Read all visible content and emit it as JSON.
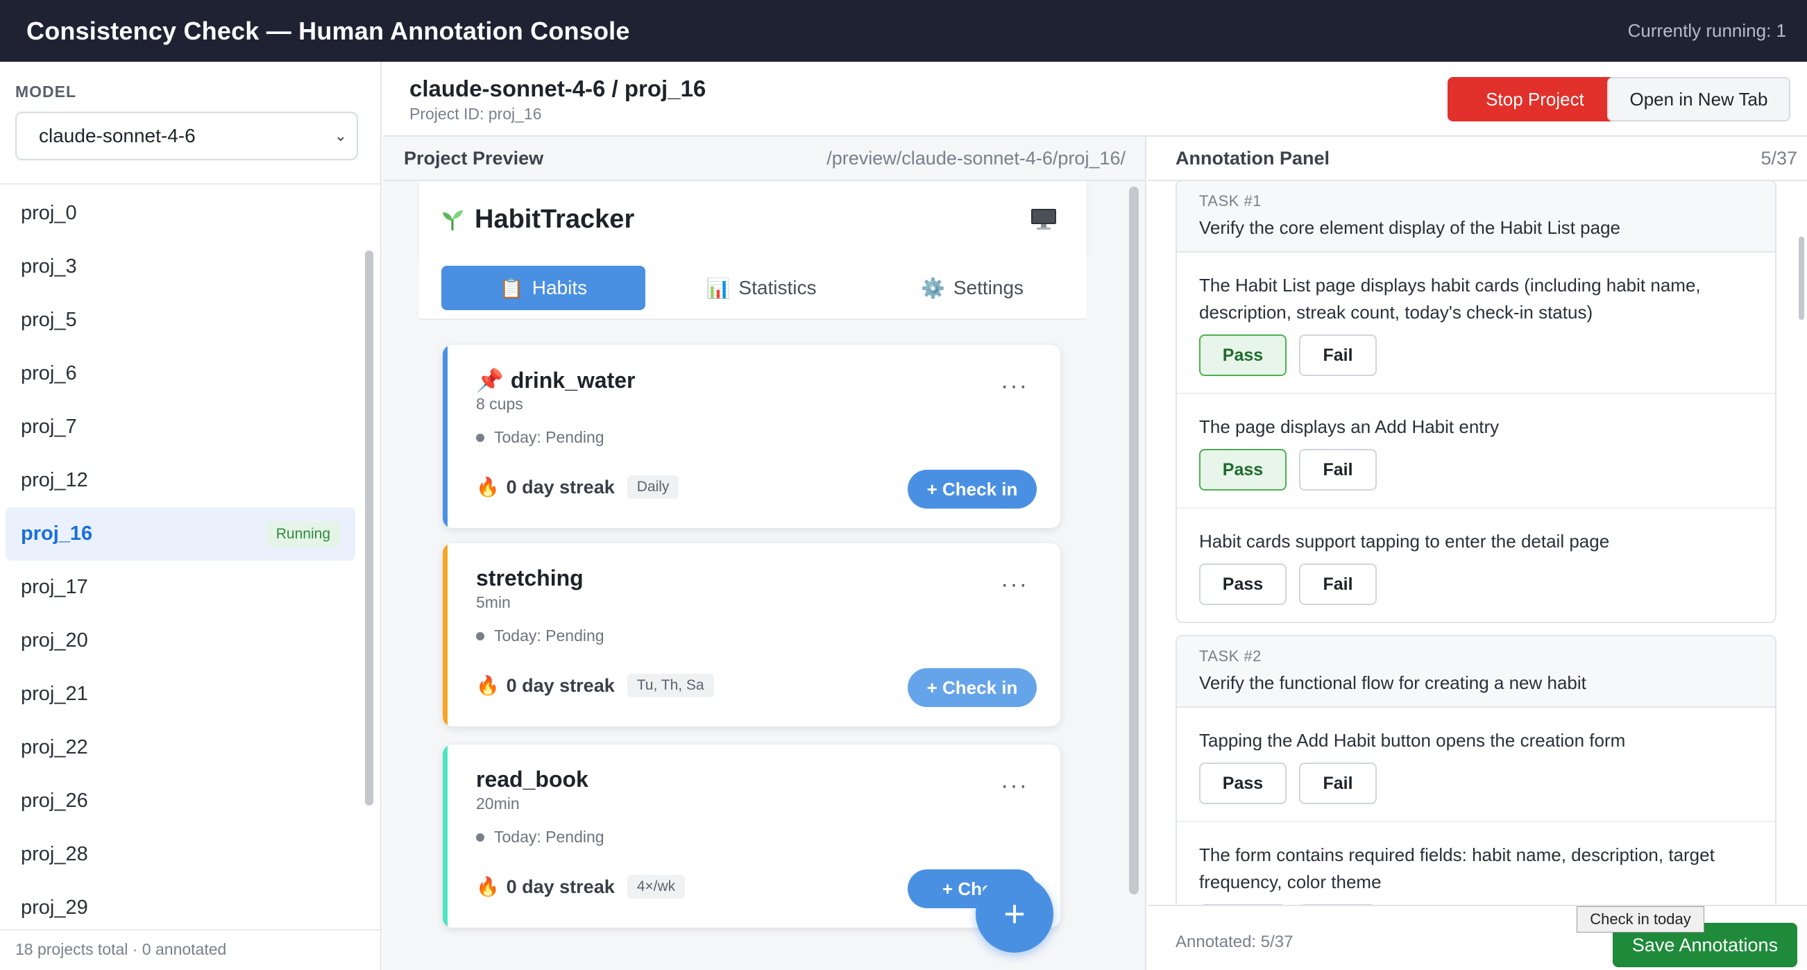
{
  "topbar": {
    "title": "Consistency Check — Human Annotation Console",
    "running": "Currently running: 1"
  },
  "sidebar": {
    "model_label": "MODEL",
    "model_value": "claude-sonnet-4-6",
    "projects": [
      {
        "label": "proj_0"
      },
      {
        "label": "proj_3"
      },
      {
        "label": "proj_5"
      },
      {
        "label": "proj_6"
      },
      {
        "label": "proj_7"
      },
      {
        "label": "proj_12"
      },
      {
        "label": "proj_16",
        "badge": "Running",
        "active": true
      },
      {
        "label": "proj_17"
      },
      {
        "label": "proj_20"
      },
      {
        "label": "proj_21"
      },
      {
        "label": "proj_22"
      },
      {
        "label": "proj_26"
      },
      {
        "label": "proj_28"
      },
      {
        "label": "proj_29"
      }
    ],
    "footer": "18 projects total · 0 annotated"
  },
  "main": {
    "title": "claude-sonnet-4-6 / proj_16",
    "subtitle": "Project ID: proj_16",
    "stop_label": "Stop Project",
    "open_label": "Open in New Tab"
  },
  "preview": {
    "label": "Project Preview",
    "path": "/preview/claude-sonnet-4-6/proj_16/",
    "app": {
      "name": "HabitTracker",
      "tabs": [
        {
          "icon": "📋",
          "label": "Habits"
        },
        {
          "icon": "📊",
          "label": "Statistics"
        },
        {
          "icon": "⚙️",
          "label": "Settings"
        }
      ],
      "cards": [
        {
          "pin": "📌",
          "name": "drink_water",
          "desc": "8 cups",
          "status": "Today: Pending",
          "streak": "0 day streak",
          "freq": "Daily",
          "checkin": "+ Check in",
          "color": "#4a90e2"
        },
        {
          "pin": "",
          "name": "stretching",
          "desc": "5min",
          "status": "Today: Pending",
          "streak": "0 day streak",
          "freq": "Tu, Th, Sa",
          "checkin": "+ Check in",
          "color": "#f5a623"
        },
        {
          "pin": "",
          "name": "read_book",
          "desc": "20min",
          "status": "Today: Pending",
          "streak": "0 day streak",
          "freq": "4×/wk",
          "checkin": "+ Chec",
          "color": "#50e3c2"
        }
      ],
      "more": "···",
      "fab": "+"
    }
  },
  "annotation": {
    "label": "Annotation Panel",
    "count": "5/37",
    "pass_label": "Pass",
    "fail_label": "Fail",
    "tasks": [
      {
        "no": "TASK #1",
        "title": "Verify the core element display of the Habit List page",
        "criteria": [
          "The Habit List page displays habit cards (including habit name, description, streak count, today's check-in status)",
          "The page displays an Add Habit entry",
          "Habit cards support tapping to enter the detail page"
        ]
      },
      {
        "no": "TASK #2",
        "title": "Verify the functional flow for creating a new habit",
        "criteria": [
          "Tapping the Add Habit button opens the creation form",
          "The form contains required fields: habit name, description, target frequency, color theme"
        ]
      }
    ],
    "annotated": "Annotated: 5/37",
    "save_label": "Save Annotations",
    "tooltip": "Check in today"
  }
}
